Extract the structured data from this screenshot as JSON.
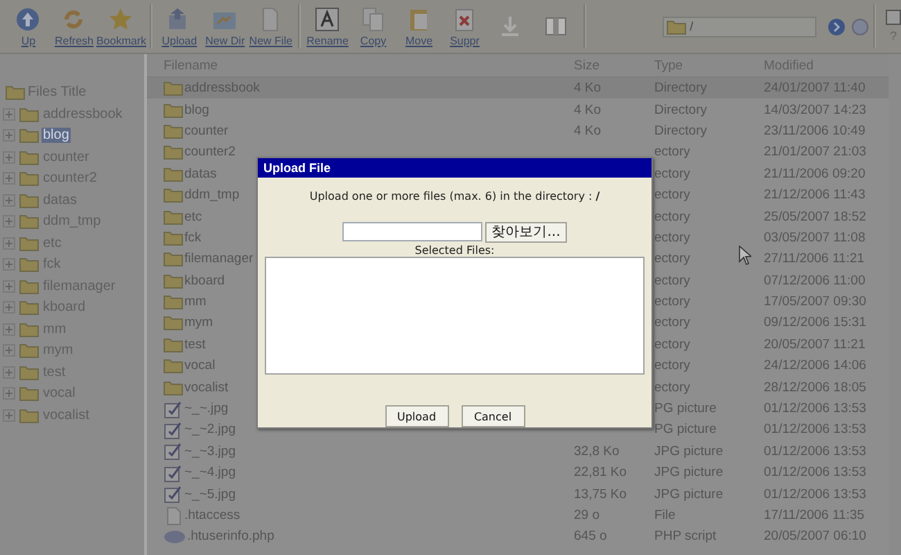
{
  "toolbar": {
    "items": [
      {
        "label": "Up",
        "disabled": false
      },
      {
        "label": "Refresh",
        "disabled": false
      },
      {
        "label": "Bookmark",
        "disabled": false
      },
      {
        "label": "Upload",
        "disabled": false
      },
      {
        "label": "New Dir",
        "disabled": false
      },
      {
        "label": "New File",
        "disabled": false
      },
      {
        "label": "Rename",
        "disabled": false
      },
      {
        "label": "Copy",
        "disabled": false
      },
      {
        "label": "Move",
        "disabled": false
      },
      {
        "label": "Suppr",
        "disabled": false
      },
      {
        "disabled": true
      },
      {
        "disabled": true
      }
    ],
    "path": "/",
    "checkbox": {
      "label": "?",
      "checked": false
    }
  },
  "tree": {
    "root": "Files Title",
    "children": [
      {
        "label": "addressbook",
        "expanded": false,
        "selected": false
      },
      {
        "label": "blog",
        "expanded": false,
        "selected": true
      },
      {
        "label": "counter",
        "expanded": false,
        "selected": false
      },
      {
        "label": "counter2",
        "expanded": false,
        "selected": false
      },
      {
        "label": "datas",
        "expanded": false,
        "selected": false
      },
      {
        "label": "ddm_tmp",
        "expanded": false,
        "selected": false
      },
      {
        "label": "etc",
        "expanded": false,
        "selected": false
      },
      {
        "label": "fck",
        "expanded": false,
        "selected": false
      },
      {
        "label": "filemanager",
        "expanded": false,
        "selected": false
      },
      {
        "label": "kboard",
        "expanded": false,
        "selected": false
      },
      {
        "label": "mm",
        "expanded": false,
        "selected": false
      },
      {
        "label": "mym",
        "expanded": false,
        "selected": false
      },
      {
        "label": "test",
        "expanded": false,
        "selected": false
      },
      {
        "label": "vocal",
        "expanded": false,
        "selected": false
      },
      {
        "label": "vocalist",
        "expanded": false,
        "selected": false
      }
    ]
  },
  "table": {
    "columns": [
      "Filename",
      "Size",
      "Type",
      "Modified"
    ],
    "rows": [
      {
        "kind": "folder",
        "name": "addressbook",
        "size": "4 Ko",
        "type": "Directory",
        "modified": "24/01/2007 11:40",
        "selected": true
      },
      {
        "kind": "folder",
        "name": "blog",
        "size": "4 Ko",
        "type": "Directory",
        "modified": "14/03/2007 14:23",
        "selected": false
      },
      {
        "kind": "folder",
        "name": "counter",
        "size": "4 Ko",
        "type": "Directory",
        "modified": "23/11/2006 10:49",
        "selected": false
      },
      {
        "kind": "folder",
        "name": "counter2",
        "type": "ectory",
        "modified": "21/01/2007 21:03",
        "selected": false
      },
      {
        "kind": "folder",
        "name": "datas",
        "type": "ectory",
        "modified": "21/11/2006 09:20",
        "selected": false
      },
      {
        "kind": "folder",
        "name": "ddm_tmp",
        "type": "ectory",
        "modified": "21/12/2006 11:43",
        "selected": false
      },
      {
        "kind": "folder",
        "name": "etc",
        "type": "ectory",
        "modified": "25/05/2007 18:52",
        "selected": false
      },
      {
        "kind": "folder",
        "name": "fck",
        "type": "ectory",
        "modified": "03/05/2007 11:08",
        "selected": false
      },
      {
        "kind": "folder",
        "name": "filemanager",
        "type": "ectory",
        "modified": "27/11/2006 11:21",
        "selected": false
      },
      {
        "kind": "folder",
        "name": "kboard",
        "type": "ectory",
        "modified": "07/12/2006 11:00",
        "selected": false
      },
      {
        "kind": "folder",
        "name": "mm",
        "type": "ectory",
        "modified": "17/05/2007 09:30",
        "selected": false
      },
      {
        "kind": "folder",
        "name": "mym",
        "type": "ectory",
        "modified": "09/12/2006 15:31",
        "selected": false
      },
      {
        "kind": "folder",
        "name": "test",
        "type": "ectory",
        "modified": "20/05/2007 11:21",
        "selected": false
      },
      {
        "kind": "folder",
        "name": "vocal",
        "type": "ectory",
        "modified": "24/12/2006 14:06",
        "selected": false
      },
      {
        "kind": "folder",
        "name": "vocalist",
        "type": "ectory",
        "modified": "28/12/2006 18:05",
        "selected": false
      },
      {
        "kind": "image",
        "name": "~_~.jpg",
        "type": "PG picture",
        "modified": "01/12/2006 13:53",
        "selected": false
      },
      {
        "kind": "image",
        "name": "~_~2.jpg",
        "type": "PG picture",
        "modified": "01/12/2006 13:53",
        "selected": false
      },
      {
        "kind": "image",
        "name": "~_~3.jpg",
        "size": "32,8 Ko",
        "type": "JPG picture",
        "modified": "01/12/2006 13:53",
        "selected": false
      },
      {
        "kind": "image",
        "name": "~_~4.jpg",
        "size": "22,81 Ko",
        "type": "JPG picture",
        "modified": "01/12/2006 13:53",
        "selected": false
      },
      {
        "kind": "image",
        "name": "~_~5.jpg",
        "size": "13,75 Ko",
        "type": "JPG picture",
        "modified": "01/12/2006 13:53",
        "selected": false
      },
      {
        "kind": "file",
        "name": ".htaccess",
        "size": "29 o",
        "type": "File",
        "modified": "17/11/2006 11:35",
        "selected": false
      },
      {
        "kind": "php",
        "name": ".htuserinfo.php",
        "size": "645 o",
        "type": "PHP script",
        "modified": "20/05/2007 06:10",
        "selected": false
      }
    ]
  },
  "dialog": {
    "title": "Upload File",
    "message": "Upload one or more files (max. 6) in the directory : **/**",
    "browse_button": "찾아보기...",
    "selected_files_label": "Selected Files:",
    "buttons": [
      "Upload",
      "Cancel"
    ]
  }
}
